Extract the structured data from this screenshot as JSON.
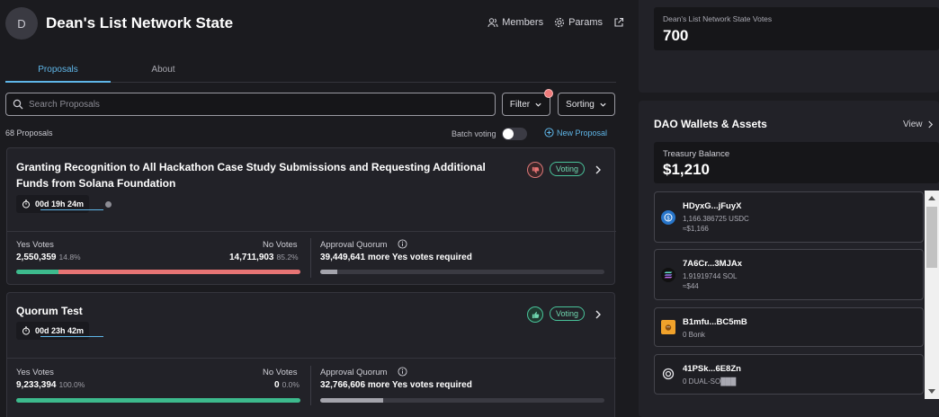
{
  "header": {
    "avatar_letter": "D",
    "title": "Dean's List Network State",
    "members_label": "Members",
    "params_label": "Params"
  },
  "tabs": [
    {
      "label": "Proposals",
      "active": true
    },
    {
      "label": "About",
      "active": false
    }
  ],
  "search": {
    "placeholder": "Search Proposals",
    "value": ""
  },
  "toolbar": {
    "filter_label": "Filter",
    "sorting_label": "Sorting"
  },
  "list": {
    "count_label": "68 Proposals",
    "batch_voting_label": "Batch voting",
    "batch_voting_on": false,
    "new_proposal_label": "New Proposal"
  },
  "proposals": [
    {
      "title_line1": "Granting Recognition to All Hackathon Case Study Submissions and Requesting Additional",
      "title_line2": "Funds from Solana Foundation",
      "timer": "00d  19h  24m",
      "status": "Voting",
      "vote_icon": "thumbs-down-icon",
      "yes_label": "Yes Votes",
      "yes_value": "2,550,359",
      "yes_pct": "14.8%",
      "yes_fraction": 0.148,
      "no_label": "No Votes",
      "no_value": "14,711,903",
      "no_pct": "85.2%",
      "quorum_label": "Approval Quorum",
      "quorum_text": "39,449,641 more Yes votes required",
      "quorum_fraction": 0.06
    },
    {
      "title_line1": "Quorum Test",
      "title_line2": "",
      "timer": "00d  23h  42m",
      "status": "Voting",
      "vote_icon": "thumbs-up-icon",
      "yes_label": "Yes Votes",
      "yes_value": "9,233,394",
      "yes_pct": "100.0%",
      "yes_fraction": 1.0,
      "no_label": "No Votes",
      "no_value": "0",
      "no_pct": "0.0%",
      "quorum_label": "Approval Quorum",
      "quorum_text": "32,766,606 more Yes votes required",
      "quorum_fraction": 0.22
    }
  ],
  "sidebar": {
    "votes_label": "Dean's List Network State Votes",
    "votes_value": "700",
    "wallets_title": "DAO Wallets & Assets",
    "view_label": "View",
    "treasury_label": "Treasury Balance",
    "treasury_value": "$1,210",
    "assets": [
      {
        "name": "HDyxG...jFuyX",
        "amount": "1,166.386725 USDC",
        "usd": "≈$1,166",
        "icon": "usdc-icon",
        "color": "#2775ca"
      },
      {
        "name": "7A6Cr...3MJAx",
        "amount": "1.91919744 SOL",
        "usd": "≈$44",
        "icon": "solana-icon",
        "color": "#111111"
      },
      {
        "name": "B1mfu...BC5mB",
        "amount": "0 Bonk",
        "usd": "",
        "icon": "bonk-icon",
        "color": "#f1a22b"
      },
      {
        "name": "41PSk...6E8Zn",
        "amount": "0 DUAL-SO███",
        "usd": "",
        "icon": "dual-icon",
        "color": "#1e1e23"
      }
    ]
  },
  "colors": {
    "accent": "#5fb6e8",
    "yes": "#3dba8d",
    "no": "#e77474",
    "status": "#6fd6ae"
  }
}
